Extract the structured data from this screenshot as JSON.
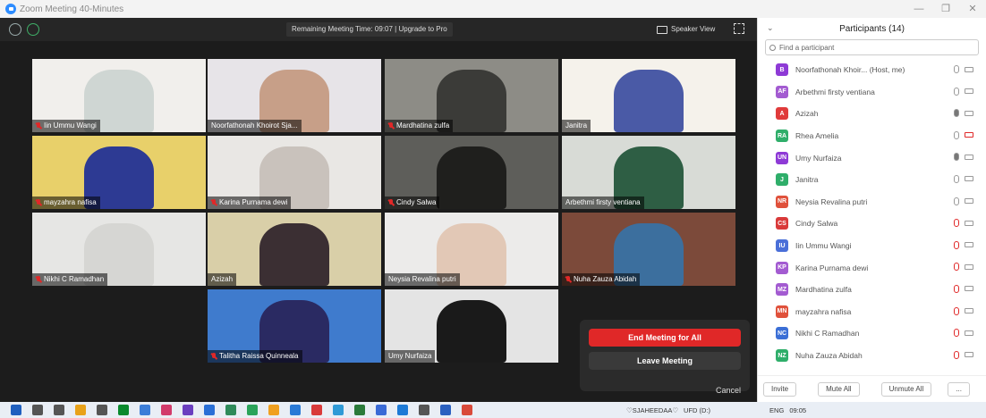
{
  "window": {
    "title": "Zoom Meeting 40-Minutes",
    "minimize": "—",
    "restore": "❐",
    "close": "✕"
  },
  "topbar": {
    "remaining": "Remaining Meeting Time: 09:07 | Upgrade to Pro",
    "speaker_view": "Speaker View"
  },
  "tiles": [
    {
      "name": "Iin Ummu Wangi",
      "muted": true,
      "bg": "#f1efec",
      "vid": "#cfd6d3"
    },
    {
      "name": "Noorfathonah Khoirot Sja...",
      "muted": false,
      "bg": "#e7e4e8",
      "vid": "#c79f88"
    },
    {
      "name": "Mardhatina zulfa",
      "muted": true,
      "bg": "#8d8c86",
      "vid": "#3b3b38"
    },
    {
      "name": "Janitra",
      "muted": false,
      "bg": "#f5f2eb",
      "vid": "#4a5aa6"
    },
    {
      "name": "mayzahra nafisa",
      "muted": true,
      "bg": "#e8d06a",
      "vid": "#2d3a93"
    },
    {
      "name": "Karina Purnama dewi",
      "muted": true,
      "bg": "#e9e7e4",
      "vid": "#c9c2bc"
    },
    {
      "name": "Cindy Salwa",
      "muted": true,
      "bg": "#5e5e5a",
      "vid": "#1f1f1d"
    },
    {
      "name": "Arbethmi firsty ventiana",
      "muted": false,
      "bg": "#d8dbd6",
      "vid": "#2e5e44"
    },
    {
      "name": "Nikhi C Ramadhan",
      "muted": true,
      "bg": "#e6e6e4",
      "vid": "#d6d6d3"
    },
    {
      "name": "Azizah",
      "muted": false,
      "bg": "#d9cfa8",
      "vid": "#3b2f33"
    },
    {
      "name": "Neysia Revalina putri",
      "muted": false,
      "bg": "#ecebea",
      "vid": "#e2c8b6"
    },
    {
      "name": "Nuha Zauza Abidah",
      "muted": true,
      "bg": "#7c4a3a",
      "vid": "#3c6f9e"
    },
    {
      "name": "Talitha Raissa Quinneala",
      "muted": true,
      "bg": "#3f7bcd",
      "vid": "#2a2a62"
    },
    {
      "name": "Umy Nurfaiza",
      "muted": false,
      "bg": "#e4e4e4",
      "vid": "#1a1a1a"
    }
  ],
  "popup": {
    "end": "End Meeting for All",
    "leave": "Leave Meeting",
    "cancel": "Cancel"
  },
  "panel": {
    "title": "Participants (14)",
    "search_placeholder": "Find a participant",
    "participants": [
      {
        "initials": "B",
        "name": "Noorfathonah Khoir...  (Host, me)",
        "color": "#8e3ad6",
        "mic": "on",
        "cam": "on"
      },
      {
        "initials": "AF",
        "name": "Arbethmi firsty ventiana",
        "color": "#a35bd1",
        "mic": "on",
        "cam": "on"
      },
      {
        "initials": "A",
        "name": "Azizah",
        "color": "#e03b3b",
        "mic": "active",
        "cam": "on"
      },
      {
        "initials": "RA",
        "name": "Rhea Amelia",
        "color": "#2fae6a",
        "mic": "on",
        "cam": "off"
      },
      {
        "initials": "UN",
        "name": "Umy Nurfaiza",
        "color": "#8e3ad6",
        "mic": "active",
        "cam": "on"
      },
      {
        "initials": "J",
        "name": "Janitra",
        "color": "#2fae6a",
        "mic": "on",
        "cam": "on"
      },
      {
        "initials": "NR",
        "name": "Neysia Revalina putri",
        "color": "#e0513b",
        "mic": "on",
        "cam": "on"
      },
      {
        "initials": "CS",
        "name": "Cindy Salwa",
        "color": "#d93a3a",
        "mic": "off",
        "cam": "on"
      },
      {
        "initials": "IU",
        "name": "Iin Ummu Wangi",
        "color": "#4a6fd8",
        "mic": "off",
        "cam": "on"
      },
      {
        "initials": "KP",
        "name": "Karina Purnama dewi",
        "color": "#a35bd1",
        "mic": "off",
        "cam": "on"
      },
      {
        "initials": "MZ",
        "name": "Mardhatina zulfa",
        "color": "#a35bd1",
        "mic": "off",
        "cam": "on"
      },
      {
        "initials": "MN",
        "name": "mayzahra nafisa",
        "color": "#e0513b",
        "mic": "off",
        "cam": "on"
      },
      {
        "initials": "NC",
        "name": "Nikhi C Ramadhan",
        "color": "#3b6fd6",
        "mic": "off",
        "cam": "on"
      },
      {
        "initials": "NZ",
        "name": "Nuha Zauza Abidah",
        "color": "#2fae6a",
        "mic": "off",
        "cam": "on"
      }
    ],
    "footer": {
      "invite": "Invite",
      "mute_all": "Mute All",
      "unmute_all": "Unmute All",
      "more": "..."
    }
  },
  "taskbar": {
    "tray_user": "♡SJAHEEDAA♡",
    "drive": "UFD (D:)",
    "lang": "ENG",
    "time": "09:05"
  },
  "colors": {
    "accent": "#2d8cff",
    "danger": "#e02828"
  }
}
